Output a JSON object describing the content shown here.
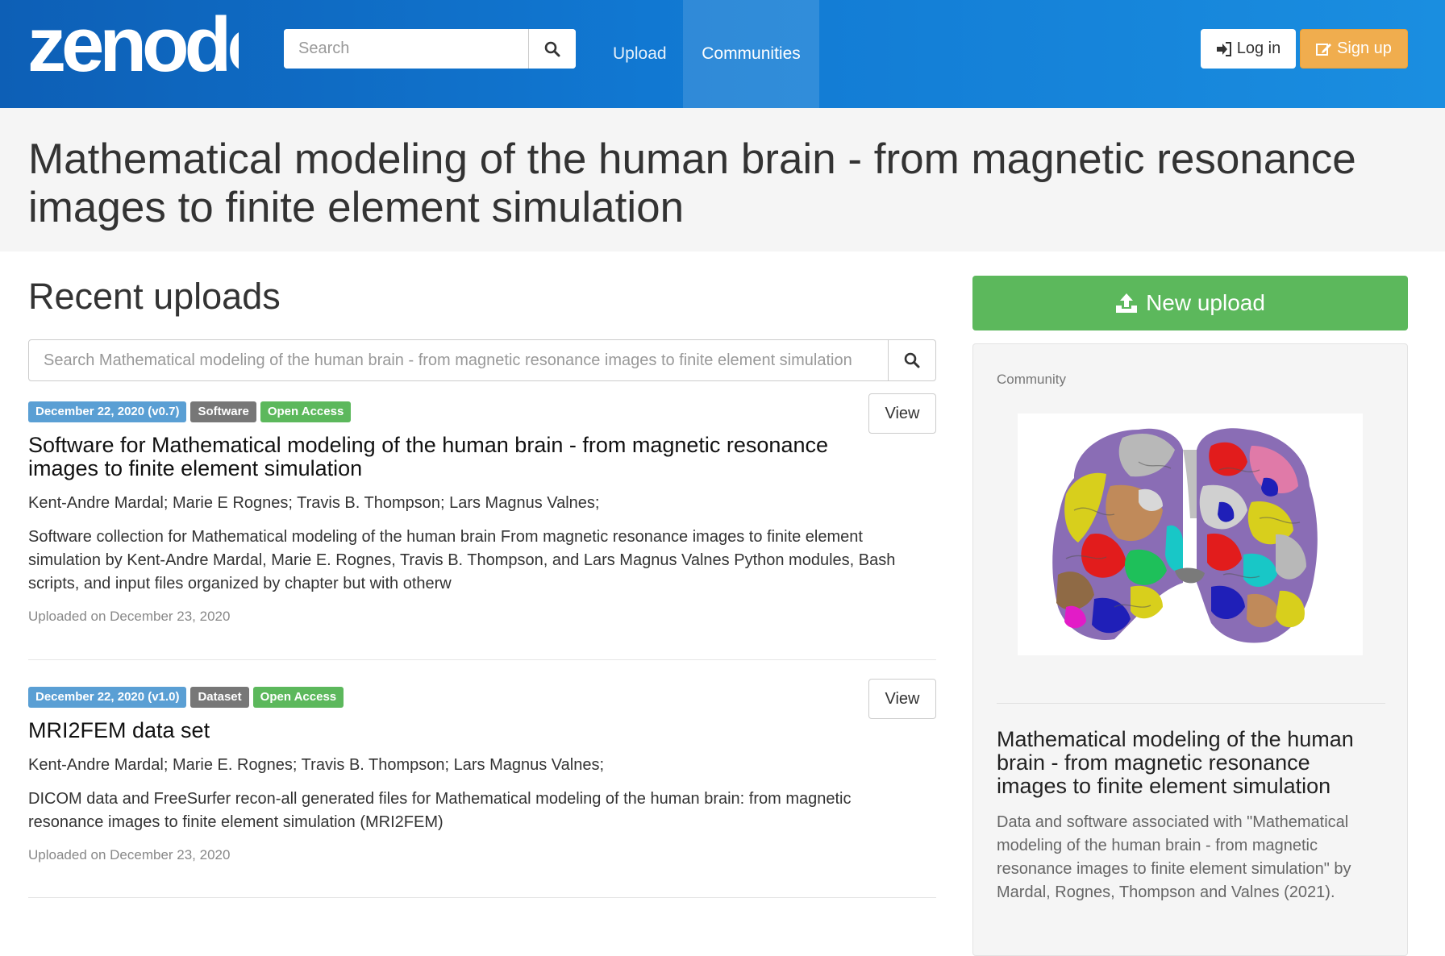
{
  "navbar": {
    "logo_text": "zenodo",
    "search_placeholder": "Search",
    "links": [
      "Upload",
      "Communities"
    ],
    "login_label": "Log in",
    "signup_label": "Sign up"
  },
  "header": {
    "title": "Mathematical modeling of the human brain - from magnetic resonance images to finite element simulation"
  },
  "recent": {
    "title": "Recent uploads",
    "search_placeholder": "Search Mathematical modeling of the human brain - from magnetic resonance images to finite element simulation",
    "records": [
      {
        "date_badge": "December 22, 2020 (v0.7)",
        "type_badge": "Software",
        "access_badge": "Open Access",
        "view_label": "View",
        "title": "Software for Mathematical modeling of the human brain - from magnetic resonance images to finite element simulation",
        "authors": "Kent-Andre Mardal; Marie E Rognes; Travis B. Thompson; Lars Magnus Valnes;",
        "description": "Software collection for  Mathematical modeling of the human brain From magnetic resonance images to finite element simulation by Kent-Andre Mardal, Marie E. Rognes, Travis B. Thompson, and Lars Magnus Valnes Python modules, Bash scripts, and input files organized by chapter but with otherw",
        "uploaded": "Uploaded on December 23, 2020"
      },
      {
        "date_badge": "December 22, 2020 (v1.0)",
        "type_badge": "Dataset",
        "access_badge": "Open Access",
        "view_label": "View",
        "title": "MRI2FEM data set",
        "authors": "Kent-Andre Mardal; Marie E. Rognes; Travis B. Thompson; Lars Magnus Valnes;",
        "description": "DICOM data and FreeSurfer recon-all generated files for Mathematical modeling of the human brain: from magnetic resonance images to finite element simulation (MRI2FEM)",
        "uploaded": "Uploaded on December 23, 2020"
      }
    ]
  },
  "sidebar": {
    "new_upload_label": "New upload",
    "panel_label": "Community",
    "community_title": "Mathematical modeling of the human brain - from magnetic resonance images to finite element simulation",
    "community_description": "Data and software associated with \"Mathematical modeling of the human brain - from magnetic resonance images to finite element simulation\" by Mardal, Rognes, Thompson and Valnes (2021)."
  },
  "colors": {
    "navbar_start": "#0d5fb6",
    "navbar_end": "#1a8ee0",
    "signup": "#f0ad4e",
    "success": "#5cb85c",
    "date_badge": "#5a9fd4",
    "type_badge": "#777777"
  },
  "icons": [
    "search-icon",
    "sign-in-icon",
    "edit-icon",
    "upload-icon"
  ]
}
